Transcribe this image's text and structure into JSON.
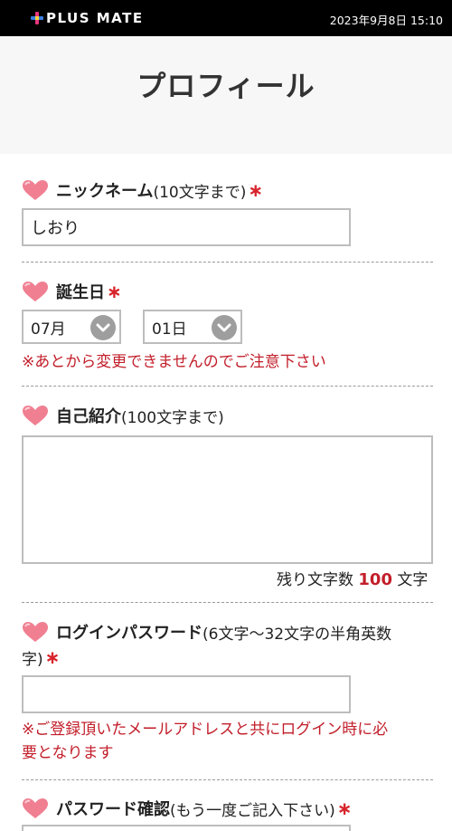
{
  "status_bar": {
    "app_name": "PLUS MATE",
    "timestamp": "2023年9月8日 15:10"
  },
  "page": {
    "title": "プロフィール"
  },
  "nickname": {
    "label": "ニックネーム",
    "note": "(10文字まで)",
    "required_mark": "∗",
    "value": "しおり"
  },
  "birthday": {
    "label": "誕生日",
    "required_mark": "∗",
    "month_value": "07月",
    "day_value": "01日",
    "warning": "※あとから変更できませんのでご注意下さい"
  },
  "self_intro": {
    "label": "自己紹介",
    "note": "(100文字まで)",
    "value": "",
    "counter_prefix": "残り文字数",
    "counter_value": "100",
    "counter_suffix": "文字"
  },
  "login_password": {
    "label": "ログインパスワード",
    "note_line1": "(6文字～32文字の半角英数",
    "note_line2": "字)",
    "required_mark": "∗",
    "value": "",
    "warning_line1": "※ご登録頂いたメールアドレスと共にログイン時に必",
    "warning_line2": "要となります"
  },
  "password_confirm": {
    "label": "パスワード確認",
    "note": "(もう一度ご記入下さい)",
    "required_mark": "∗"
  },
  "colors": {
    "accent_red": "#c21e2a",
    "heart_pink": "#f07f92",
    "top_bar": "#000000"
  },
  "icons": {
    "section_marker": "heart-icon",
    "select_arrow": "chevron-down-icon"
  }
}
